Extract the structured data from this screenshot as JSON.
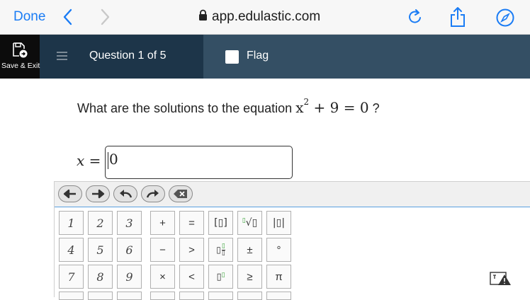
{
  "safari": {
    "done_label": "Done",
    "url": "app.edulastic.com"
  },
  "header": {
    "save_exit_label": "Save & Exit",
    "question_label": "Question 1 of 5",
    "flag_label": "Flag"
  },
  "question": {
    "prefix": "What are the solutions to the equation",
    "equation_base": "x",
    "equation_exponent": "2",
    "equation_rest": "+ 9 = 0",
    "suffix": "?"
  },
  "answer": {
    "variable": "x",
    "equals": "=",
    "value": "0"
  },
  "keypad": {
    "toolbar": [
      "undo-left-arrow",
      "redo-right-arrow",
      "undo-curved",
      "redo-curved",
      "backspace"
    ],
    "keys": [
      [
        "1",
        "2",
        "3",
        "+",
        "=",
        "[▯]",
        "∜▯",
        "|▯|"
      ],
      [
        "4",
        "5",
        "6",
        "−",
        ">",
        "▯/▯",
        "±",
        "°"
      ],
      [
        "7",
        "8",
        "9",
        "×",
        "<",
        "▯^▯",
        "≥",
        "π"
      ]
    ]
  },
  "colors": {
    "safari_link": "#1a7cf5",
    "header_bg": "#1d3549",
    "flag_bg": "#344f64",
    "keypad_accent": "#5a9fe0",
    "fraction_green": "#3aa33a"
  }
}
